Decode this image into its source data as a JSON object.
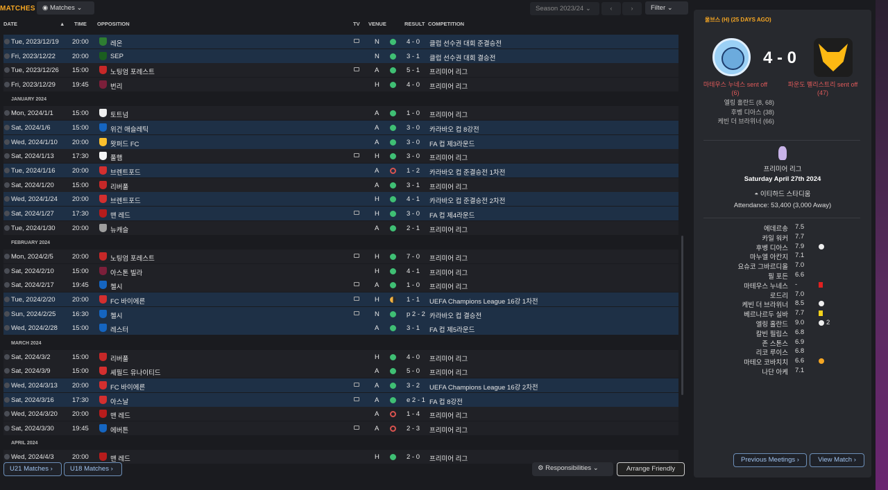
{
  "header": {
    "title": "MATCHES",
    "view_label": "Matches",
    "season": "Season 2023/24",
    "filter": "Filter"
  },
  "columns": {
    "date": "DATE",
    "time": "TIME",
    "opposition": "OPPOSITION",
    "tv": "TV",
    "venue": "VENUE",
    "result": "RESULT",
    "competition": "COMPETITION"
  },
  "rows": [
    {
      "date": "Tue, 2023/12/19",
      "time": "20:00",
      "opp": "레온",
      "tv": true,
      "venue": "N",
      "res": "w",
      "score": "4 - 0",
      "comp": "클럽 선수권 대회 준결승전",
      "alt": true,
      "crest": "#2e7d32"
    },
    {
      "date": "Fri, 2023/12/22",
      "time": "20:00",
      "opp": "SEP",
      "tv": false,
      "venue": "N",
      "res": "w",
      "score": "3 - 1",
      "comp": "클럽 선수권 대회 결승전",
      "alt": true,
      "crest": "#1b5e20"
    },
    {
      "date": "Tue, 2023/12/26",
      "time": "15:00",
      "opp": "노팅엄 포레스트",
      "tv": true,
      "venue": "A",
      "res": "w",
      "score": "5 - 1",
      "comp": "프리미어 리그",
      "alt": false,
      "crest": "#c62828"
    },
    {
      "date": "Fri, 2023/12/29",
      "time": "19:45",
      "opp": "번리",
      "tv": false,
      "venue": "H",
      "res": "w",
      "score": "4 - 0",
      "comp": "프리미어 리그",
      "alt": false,
      "crest": "#7b1f3a"
    },
    {
      "date": "Mon, 2024/1/1",
      "time": "15:00",
      "opp": "토트넘",
      "tv": false,
      "venue": "A",
      "res": "w",
      "score": "1 - 0",
      "comp": "프리미어 리그",
      "alt": false,
      "crest": "#eeeeee"
    },
    {
      "date": "Sat, 2024/1/6",
      "time": "15:00",
      "opp": "위건 애슬레틱",
      "tv": false,
      "venue": "A",
      "res": "w",
      "score": "3 - 0",
      "comp": "카라바오 컵 8강전",
      "alt": true,
      "crest": "#1565c0"
    },
    {
      "date": "Wed, 2024/1/10",
      "time": "20:00",
      "opp": "왓퍼드 FC",
      "tv": false,
      "venue": "A",
      "res": "w",
      "score": "3 - 0",
      "comp": "FA 컵 제3라운드",
      "alt": true,
      "crest": "#fbc02d"
    },
    {
      "date": "Sat, 2024/1/13",
      "time": "17:30",
      "opp": "풀햄",
      "tv": true,
      "venue": "H",
      "res": "w",
      "score": "3 - 0",
      "comp": "프리미어 리그",
      "alt": false,
      "crest": "#f5f5f5"
    },
    {
      "date": "Tue, 2024/1/16",
      "time": "20:00",
      "opp": "브렌트포드",
      "tv": false,
      "venue": "A",
      "res": "l",
      "score": "1 - 2",
      "comp": "카라바오 컵 준결승전 1차전",
      "alt": true,
      "crest": "#d32f2f"
    },
    {
      "date": "Sat, 2024/1/20",
      "time": "15:00",
      "opp": "리버풀",
      "tv": false,
      "venue": "A",
      "res": "w",
      "score": "3 - 1",
      "comp": "프리미어 리그",
      "alt": false,
      "crest": "#c62828"
    },
    {
      "date": "Wed, 2024/1/24",
      "time": "20:00",
      "opp": "브렌트포드",
      "tv": false,
      "venue": "H",
      "res": "w",
      "score": "4 - 1",
      "comp": "카라바오 컵 준결승전 2차전",
      "alt": true,
      "crest": "#d32f2f"
    },
    {
      "date": "Sat, 2024/1/27",
      "time": "17:30",
      "opp": "맨 레드",
      "tv": true,
      "venue": "H",
      "res": "w",
      "score": "3 - 0",
      "comp": "FA 컵 제4라운드",
      "alt": true,
      "crest": "#b71c1c"
    },
    {
      "date": "Tue, 2024/1/30",
      "time": "20:00",
      "opp": "뉴캐슬",
      "tv": false,
      "venue": "A",
      "res": "w",
      "score": "2 - 1",
      "comp": "프리미어 리그",
      "alt": false,
      "crest": "#9e9e9e"
    },
    {
      "date": "Mon, 2024/2/5",
      "time": "20:00",
      "opp": "노팅엄 포레스트",
      "tv": true,
      "venue": "H",
      "res": "w",
      "score": "7 - 0",
      "comp": "프리미어 리그",
      "alt": false,
      "crest": "#c62828"
    },
    {
      "date": "Sat, 2024/2/10",
      "time": "15:00",
      "opp": "아스톤 빌라",
      "tv": false,
      "venue": "H",
      "res": "w",
      "score": "4 - 1",
      "comp": "프리미어 리그",
      "alt": false,
      "crest": "#7b1f3a"
    },
    {
      "date": "Sat, 2024/2/17",
      "time": "19:45",
      "opp": "첼시",
      "tv": true,
      "venue": "A",
      "res": "w",
      "score": "1 - 0",
      "comp": "프리미어 리그",
      "alt": false,
      "crest": "#1565c0"
    },
    {
      "date": "Tue, 2024/2/20",
      "time": "20:00",
      "opp": "FC 바이에른",
      "tv": true,
      "venue": "H",
      "res": "d",
      "score": "1 - 1",
      "comp": "UEFA Champions League 16강 1차전",
      "alt": true,
      "crest": "#d32f2f"
    },
    {
      "date": "Sun, 2024/2/25",
      "time": "16:30",
      "opp": "첼시",
      "tv": true,
      "venue": "N",
      "res": "w",
      "score": "p 2 - 2",
      "comp": "카라바오 컵 결승전",
      "alt": true,
      "crest": "#1565c0"
    },
    {
      "date": "Wed, 2024/2/28",
      "time": "15:00",
      "opp": "레스터",
      "tv": false,
      "venue": "A",
      "res": "w",
      "score": "3 - 1",
      "comp": "FA 컵 제5라운드",
      "alt": true,
      "crest": "#1565c0"
    },
    {
      "date": "Sat, 2024/3/2",
      "time": "15:00",
      "opp": "리버풀",
      "tv": false,
      "venue": "H",
      "res": "w",
      "score": "4 - 0",
      "comp": "프리미어 리그",
      "alt": false,
      "crest": "#c62828"
    },
    {
      "date": "Sat, 2024/3/9",
      "time": "15:00",
      "opp": "셰필드 유나이티드",
      "tv": false,
      "venue": "A",
      "res": "w",
      "score": "5 - 0",
      "comp": "프리미어 리그",
      "alt": false,
      "crest": "#d32f2f"
    },
    {
      "date": "Wed, 2024/3/13",
      "time": "20:00",
      "opp": "FC 바이에른",
      "tv": true,
      "venue": "A",
      "res": "w",
      "score": "3 - 2",
      "comp": "UEFA Champions League 16강 2차전",
      "alt": true,
      "crest": "#d32f2f"
    },
    {
      "date": "Sat, 2024/3/16",
      "time": "17:30",
      "opp": "아스날",
      "tv": true,
      "venue": "A",
      "res": "w",
      "score": "e 2 - 1",
      "comp": "FA 컵 8강전",
      "alt": true,
      "crest": "#d32f2f"
    },
    {
      "date": "Wed, 2024/3/20",
      "time": "20:00",
      "opp": "맨 레드",
      "tv": false,
      "venue": "A",
      "res": "l",
      "score": "1 - 4",
      "comp": "프리미어 리그",
      "alt": false,
      "crest": "#b71c1c"
    },
    {
      "date": "Sat, 2024/3/30",
      "time": "19:45",
      "opp": "에버튼",
      "tv": true,
      "venue": "A",
      "res": "l",
      "score": "2 - 3",
      "comp": "프리미어 리그",
      "alt": false,
      "crest": "#1565c0"
    },
    {
      "date": "Wed, 2024/4/3",
      "time": "20:00",
      "opp": "맨 레드",
      "tv": false,
      "venue": "H",
      "res": "w",
      "score": "2 - 0",
      "comp": "프리미어 리그",
      "alt": false,
      "crest": "#b71c1c"
    }
  ],
  "months": [
    "JANUARY 2024",
    "FEBRUARY 2024",
    "MARCH 2024",
    "APRIL 2024"
  ],
  "bottom": {
    "u21": "U21 Matches",
    "u18": "U18 Matches",
    "resp": "Responsibilities",
    "arrange": "Arrange Friendly"
  },
  "panel": {
    "ago": "울브스 (H) (25 DAYS AGO)",
    "score": "4 - 0",
    "home_red": "마테우스 누네스 sent off (6)",
    "away_red": "파운도 펠리스트리 sent off (47)",
    "scorers": [
      "엘링 홀란드 (8, 68)",
      "후벵 디아스 (38)",
      "케빈 더 브라위너 (66)"
    ],
    "competition": "프리미어 리그",
    "date": "Saturday April 27th 2024",
    "stadium": "이티하드 스타디움",
    "attendance": "Attendance: 53,400 (3,000 Away)",
    "ratings": [
      {
        "name": "에데르송",
        "val": "7.5",
        "icon": ""
      },
      {
        "name": "카일 워커",
        "val": "7.7",
        "icon": ""
      },
      {
        "name": "후벵 디아스",
        "val": "7.9",
        "icon": "ball"
      },
      {
        "name": "마누엘 아칸지",
        "val": "7.1",
        "icon": ""
      },
      {
        "name": "요슈코 그바르디올",
        "val": "7.0",
        "icon": ""
      },
      {
        "name": "필 포든",
        "val": "6.6",
        "icon": ""
      },
      {
        "name": "마테우스 누네스",
        "val": "-",
        "icon": "red"
      },
      {
        "name": "로드리",
        "val": "7.0",
        "icon": ""
      },
      {
        "name": "케빈 더 브라위너",
        "val": "8.5",
        "icon": "ball"
      },
      {
        "name": "베르나르두 실바",
        "val": "7.7",
        "icon": "yellow"
      },
      {
        "name": "엘링 홀란드",
        "val": "9.0",
        "icon": "ball2"
      },
      {
        "name": "칼빈 필립스",
        "val": "6.8",
        "icon": ""
      },
      {
        "name": "존 스톤스",
        "val": "6.9",
        "icon": ""
      },
      {
        "name": "리코 루이스",
        "val": "6.8",
        "icon": ""
      },
      {
        "name": "마테오 코바치치",
        "val": "6.6",
        "icon": "star"
      },
      {
        "name": "나단 아케",
        "val": "7.1",
        "icon": ""
      }
    ],
    "prev": "Previous Meetings",
    "view": "View Match"
  }
}
